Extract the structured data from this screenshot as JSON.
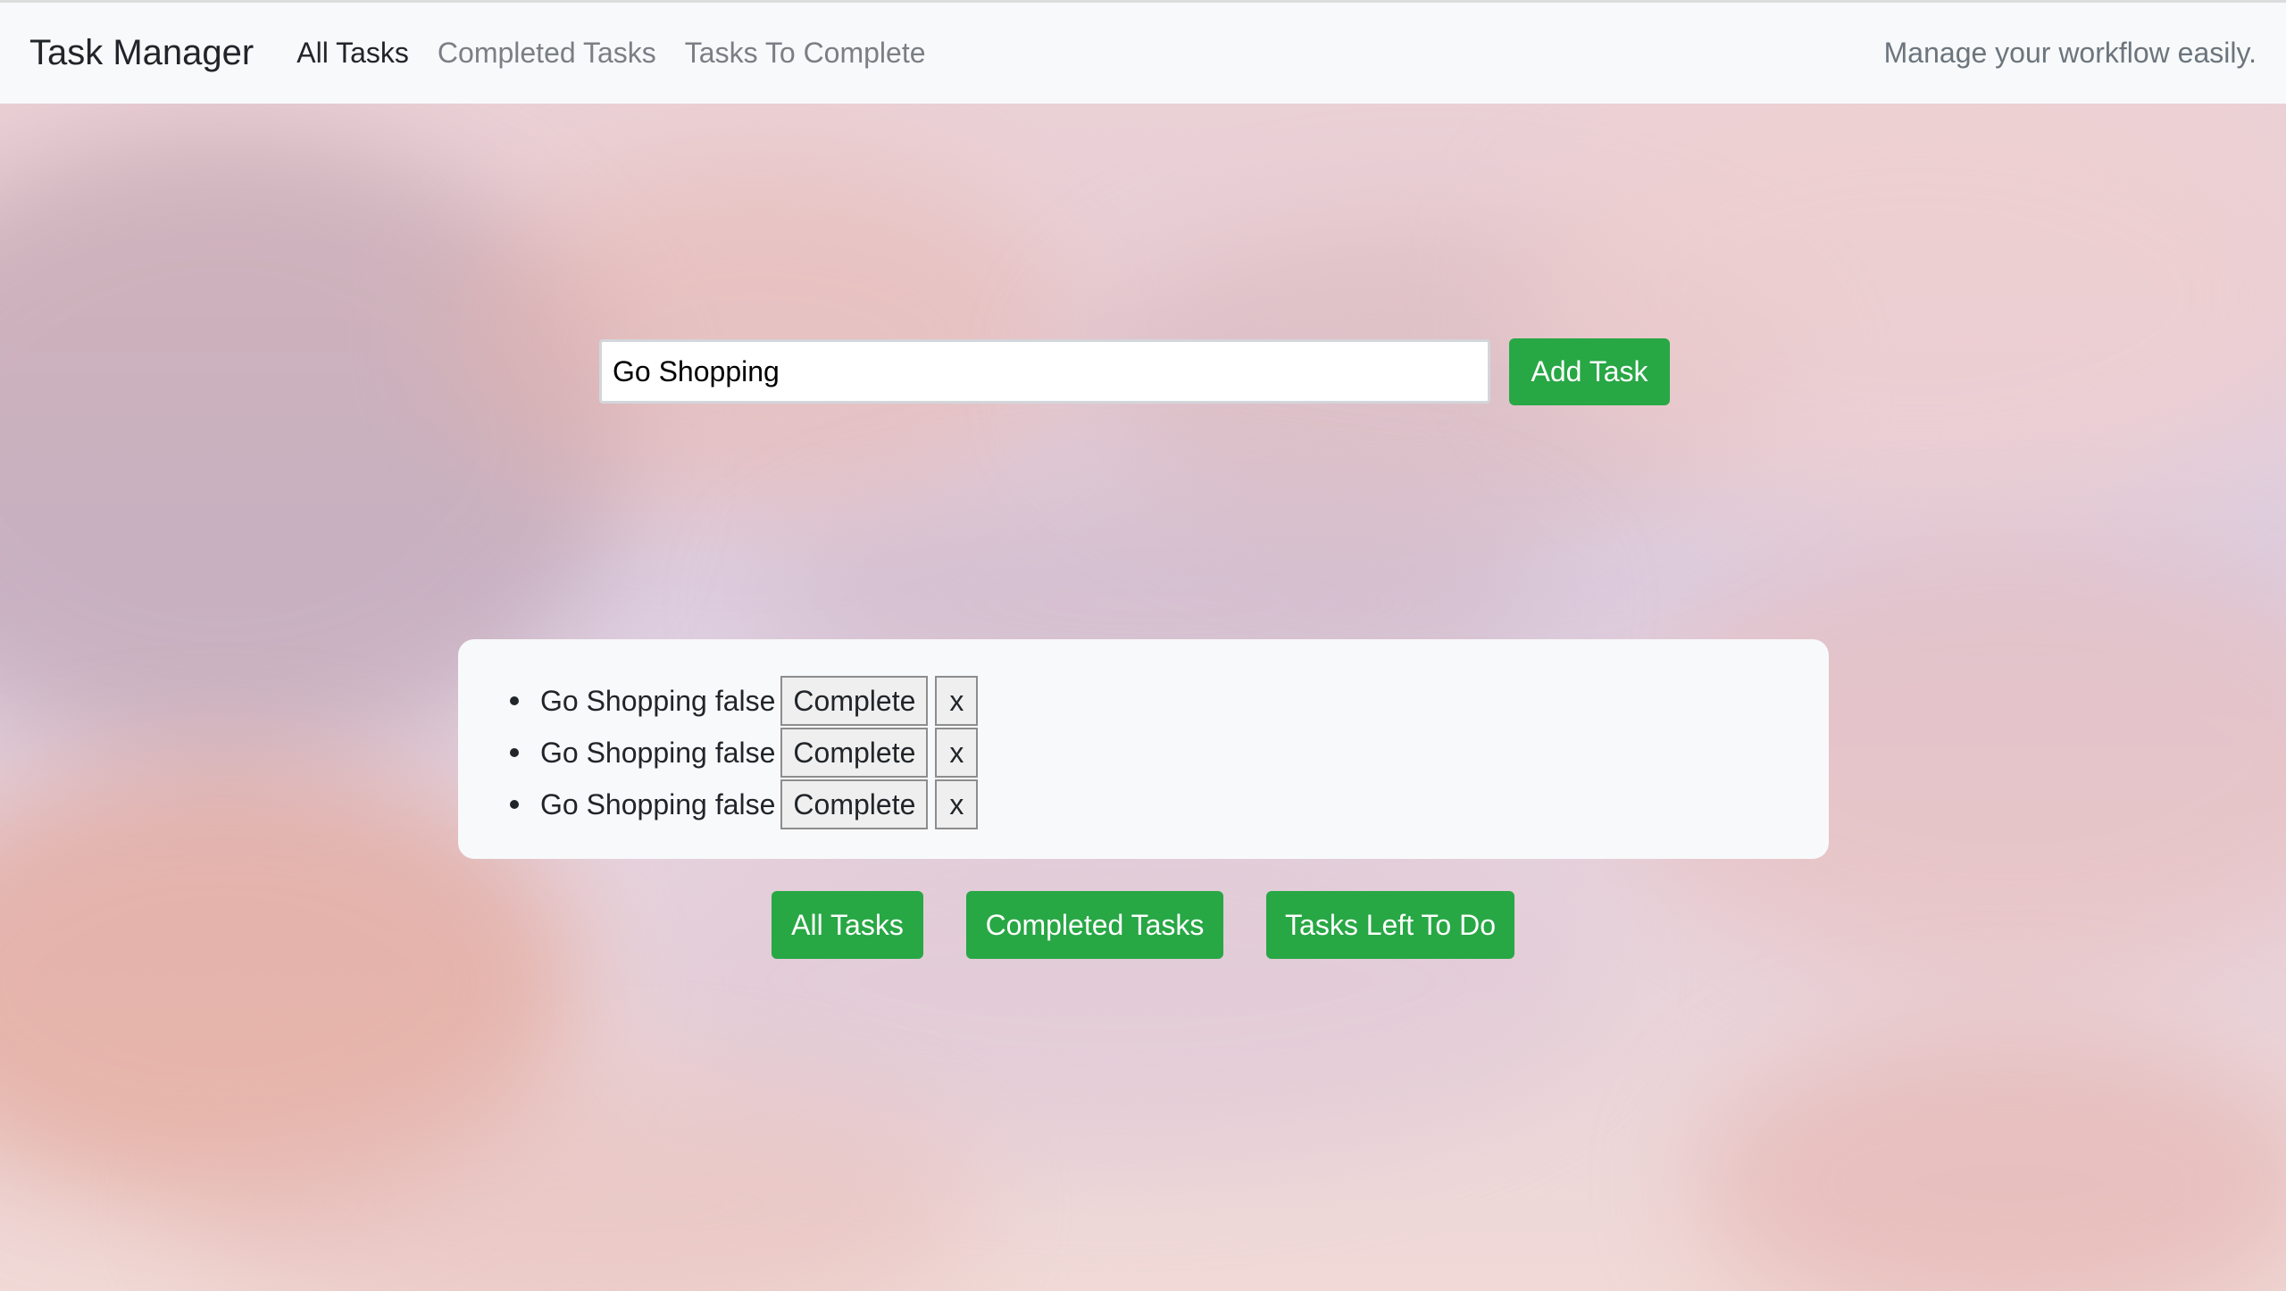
{
  "navbar": {
    "brand": "Task Manager",
    "links": [
      {
        "label": "All Tasks",
        "active": true
      },
      {
        "label": "Completed Tasks",
        "active": false
      },
      {
        "label": "Tasks To Complete",
        "active": false
      }
    ],
    "tagline": "Manage your workflow easily."
  },
  "form": {
    "input_value": "Go Shopping",
    "add_button": "Add Task"
  },
  "tasks": [
    {
      "text": "Go Shopping",
      "status": "false",
      "complete_label": "Complete",
      "delete_label": "x"
    },
    {
      "text": "Go Shopping",
      "status": "false",
      "complete_label": "Complete",
      "delete_label": "x"
    },
    {
      "text": "Go Shopping",
      "status": "false",
      "complete_label": "Complete",
      "delete_label": "x"
    }
  ],
  "filters": {
    "all": "All Tasks",
    "completed": "Completed Tasks",
    "left": "Tasks Left To Do"
  },
  "colors": {
    "accent_green": "#28a745",
    "navbar_bg": "#f8f9fa"
  }
}
